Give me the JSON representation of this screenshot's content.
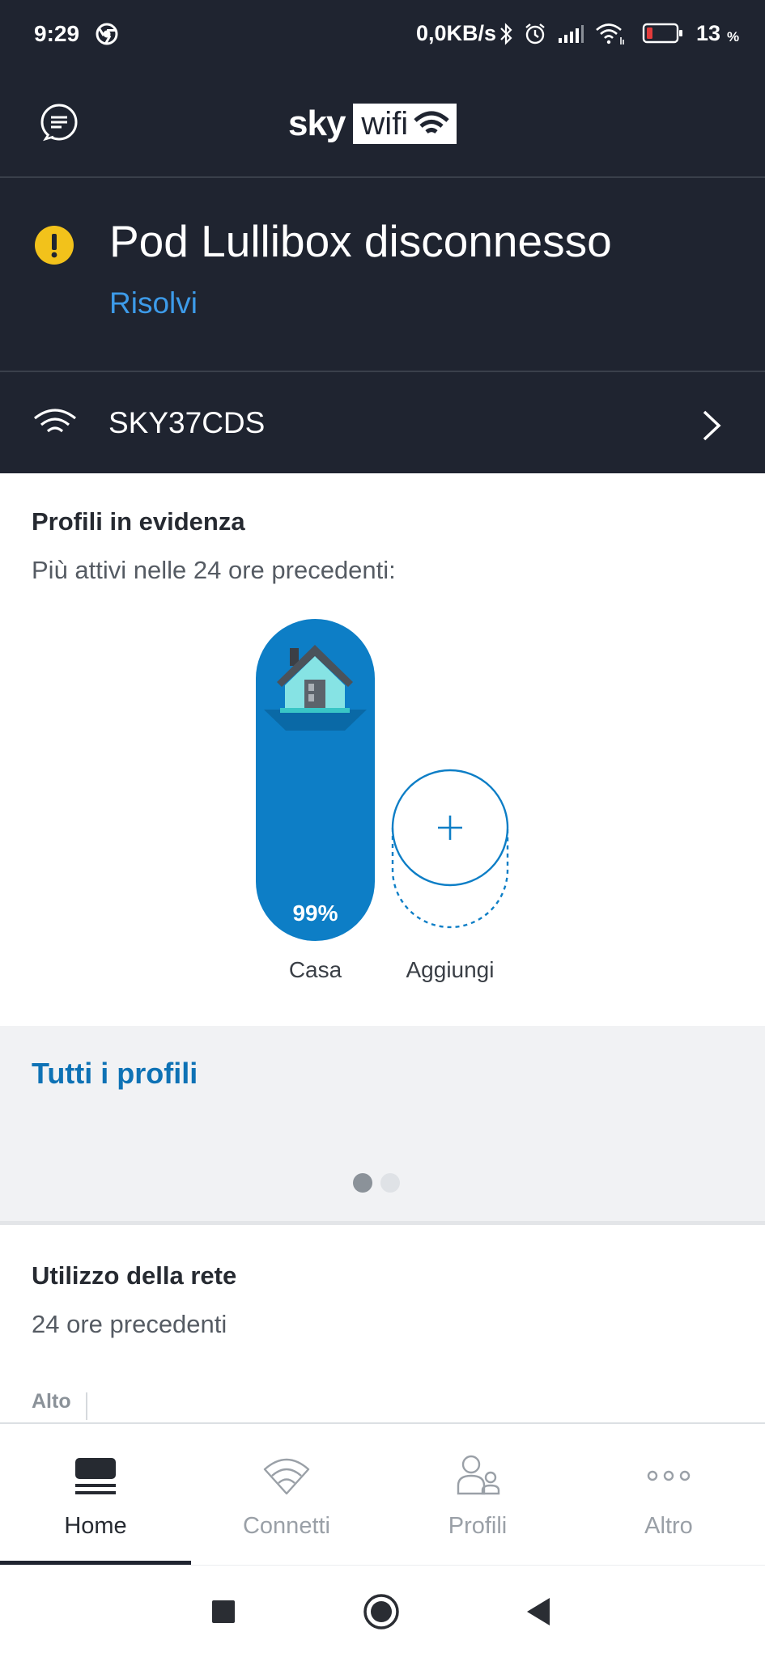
{
  "status_bar": {
    "time": "9:29",
    "speed": "0,0KB/s",
    "battery_percent": "13",
    "battery_unit": "%",
    "icons": [
      "chrome-icon",
      "bluetooth-icon",
      "alarm-icon",
      "signal-icon",
      "wifi-icon",
      "battery-icon"
    ]
  },
  "header": {
    "logo_brand": "sky",
    "logo_product": "wifi",
    "menu_icon": "menu-icon"
  },
  "alert": {
    "title": "Pod Lullibox disconnesso",
    "action": "Risolvi",
    "icon": "warning-icon",
    "icon_color": "#f2c21b"
  },
  "network": {
    "name": "SKY37CDS",
    "icon": "wifi-icon"
  },
  "profiles": {
    "title": "Profili in evidenza",
    "subtitle": "Più attivi nelle 24 ore precedenti:",
    "items": [
      {
        "label": "Casa",
        "percent": "99%",
        "icon": "house-icon",
        "color": "#0d7ec6"
      }
    ],
    "add": {
      "label": "Aggiungi",
      "icon": "plus-icon"
    }
  },
  "all_profiles": {
    "link": "Tutti i profili",
    "pager": {
      "pages": 2,
      "active": 0
    }
  },
  "usage": {
    "title": "Utilizzo della rete",
    "subtitle": "24 ore precedenti",
    "level_label": "Alto"
  },
  "bottom_nav": {
    "items": [
      {
        "label": "Home",
        "icon": "home-icon",
        "active": true
      },
      {
        "label": "Connetti",
        "icon": "wifi-icon",
        "active": false
      },
      {
        "label": "Profili",
        "icon": "profiles-icon",
        "active": false
      },
      {
        "label": "Altro",
        "icon": "more-icon",
        "active": false
      }
    ]
  },
  "system_nav": [
    "recents-icon",
    "home-circle-icon",
    "back-icon"
  ],
  "colors": {
    "header_bg": "#1f2430",
    "accent_blue": "#0d7ec6",
    "link_blue": "#3d9be9",
    "warning_yellow": "#f2c21b"
  }
}
